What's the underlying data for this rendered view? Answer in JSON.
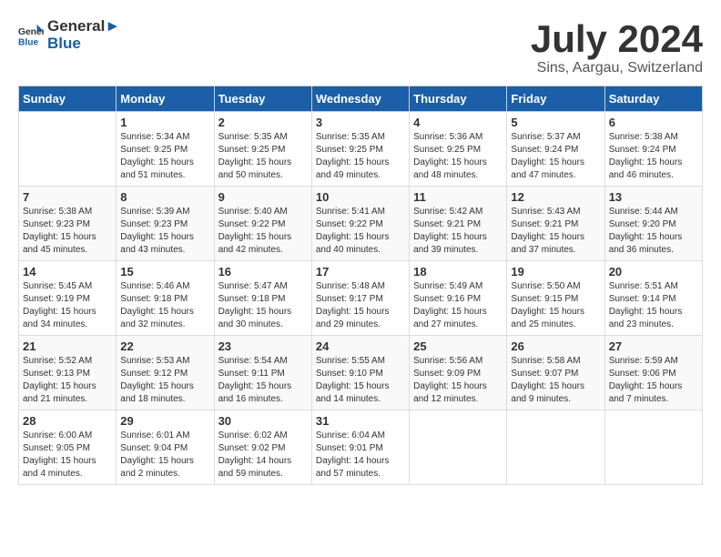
{
  "header": {
    "logo_general": "General",
    "logo_blue": "Blue",
    "title": "July 2024",
    "subtitle": "Sins, Aargau, Switzerland"
  },
  "days_of_week": [
    "Sunday",
    "Monday",
    "Tuesday",
    "Wednesday",
    "Thursday",
    "Friday",
    "Saturday"
  ],
  "weeks": [
    [
      {
        "day": "",
        "content": ""
      },
      {
        "day": "1",
        "content": "Sunrise: 5:34 AM\nSunset: 9:25 PM\nDaylight: 15 hours\nand 51 minutes."
      },
      {
        "day": "2",
        "content": "Sunrise: 5:35 AM\nSunset: 9:25 PM\nDaylight: 15 hours\nand 50 minutes."
      },
      {
        "day": "3",
        "content": "Sunrise: 5:35 AM\nSunset: 9:25 PM\nDaylight: 15 hours\nand 49 minutes."
      },
      {
        "day": "4",
        "content": "Sunrise: 5:36 AM\nSunset: 9:25 PM\nDaylight: 15 hours\nand 48 minutes."
      },
      {
        "day": "5",
        "content": "Sunrise: 5:37 AM\nSunset: 9:24 PM\nDaylight: 15 hours\nand 47 minutes."
      },
      {
        "day": "6",
        "content": "Sunrise: 5:38 AM\nSunset: 9:24 PM\nDaylight: 15 hours\nand 46 minutes."
      }
    ],
    [
      {
        "day": "7",
        "content": "Sunrise: 5:38 AM\nSunset: 9:23 PM\nDaylight: 15 hours\nand 45 minutes."
      },
      {
        "day": "8",
        "content": "Sunrise: 5:39 AM\nSunset: 9:23 PM\nDaylight: 15 hours\nand 43 minutes."
      },
      {
        "day": "9",
        "content": "Sunrise: 5:40 AM\nSunset: 9:22 PM\nDaylight: 15 hours\nand 42 minutes."
      },
      {
        "day": "10",
        "content": "Sunrise: 5:41 AM\nSunset: 9:22 PM\nDaylight: 15 hours\nand 40 minutes."
      },
      {
        "day": "11",
        "content": "Sunrise: 5:42 AM\nSunset: 9:21 PM\nDaylight: 15 hours\nand 39 minutes."
      },
      {
        "day": "12",
        "content": "Sunrise: 5:43 AM\nSunset: 9:21 PM\nDaylight: 15 hours\nand 37 minutes."
      },
      {
        "day": "13",
        "content": "Sunrise: 5:44 AM\nSunset: 9:20 PM\nDaylight: 15 hours\nand 36 minutes."
      }
    ],
    [
      {
        "day": "14",
        "content": "Sunrise: 5:45 AM\nSunset: 9:19 PM\nDaylight: 15 hours\nand 34 minutes."
      },
      {
        "day": "15",
        "content": "Sunrise: 5:46 AM\nSunset: 9:18 PM\nDaylight: 15 hours\nand 32 minutes."
      },
      {
        "day": "16",
        "content": "Sunrise: 5:47 AM\nSunset: 9:18 PM\nDaylight: 15 hours\nand 30 minutes."
      },
      {
        "day": "17",
        "content": "Sunrise: 5:48 AM\nSunset: 9:17 PM\nDaylight: 15 hours\nand 29 minutes."
      },
      {
        "day": "18",
        "content": "Sunrise: 5:49 AM\nSunset: 9:16 PM\nDaylight: 15 hours\nand 27 minutes."
      },
      {
        "day": "19",
        "content": "Sunrise: 5:50 AM\nSunset: 9:15 PM\nDaylight: 15 hours\nand 25 minutes."
      },
      {
        "day": "20",
        "content": "Sunrise: 5:51 AM\nSunset: 9:14 PM\nDaylight: 15 hours\nand 23 minutes."
      }
    ],
    [
      {
        "day": "21",
        "content": "Sunrise: 5:52 AM\nSunset: 9:13 PM\nDaylight: 15 hours\nand 21 minutes."
      },
      {
        "day": "22",
        "content": "Sunrise: 5:53 AM\nSunset: 9:12 PM\nDaylight: 15 hours\nand 18 minutes."
      },
      {
        "day": "23",
        "content": "Sunrise: 5:54 AM\nSunset: 9:11 PM\nDaylight: 15 hours\nand 16 minutes."
      },
      {
        "day": "24",
        "content": "Sunrise: 5:55 AM\nSunset: 9:10 PM\nDaylight: 15 hours\nand 14 minutes."
      },
      {
        "day": "25",
        "content": "Sunrise: 5:56 AM\nSunset: 9:09 PM\nDaylight: 15 hours\nand 12 minutes."
      },
      {
        "day": "26",
        "content": "Sunrise: 5:58 AM\nSunset: 9:07 PM\nDaylight: 15 hours\nand 9 minutes."
      },
      {
        "day": "27",
        "content": "Sunrise: 5:59 AM\nSunset: 9:06 PM\nDaylight: 15 hours\nand 7 minutes."
      }
    ],
    [
      {
        "day": "28",
        "content": "Sunrise: 6:00 AM\nSunset: 9:05 PM\nDaylight: 15 hours\nand 4 minutes."
      },
      {
        "day": "29",
        "content": "Sunrise: 6:01 AM\nSunset: 9:04 PM\nDaylight: 15 hours\nand 2 minutes."
      },
      {
        "day": "30",
        "content": "Sunrise: 6:02 AM\nSunset: 9:02 PM\nDaylight: 14 hours\nand 59 minutes."
      },
      {
        "day": "31",
        "content": "Sunrise: 6:04 AM\nSunset: 9:01 PM\nDaylight: 14 hours\nand 57 minutes."
      },
      {
        "day": "",
        "content": ""
      },
      {
        "day": "",
        "content": ""
      },
      {
        "day": "",
        "content": ""
      }
    ]
  ]
}
